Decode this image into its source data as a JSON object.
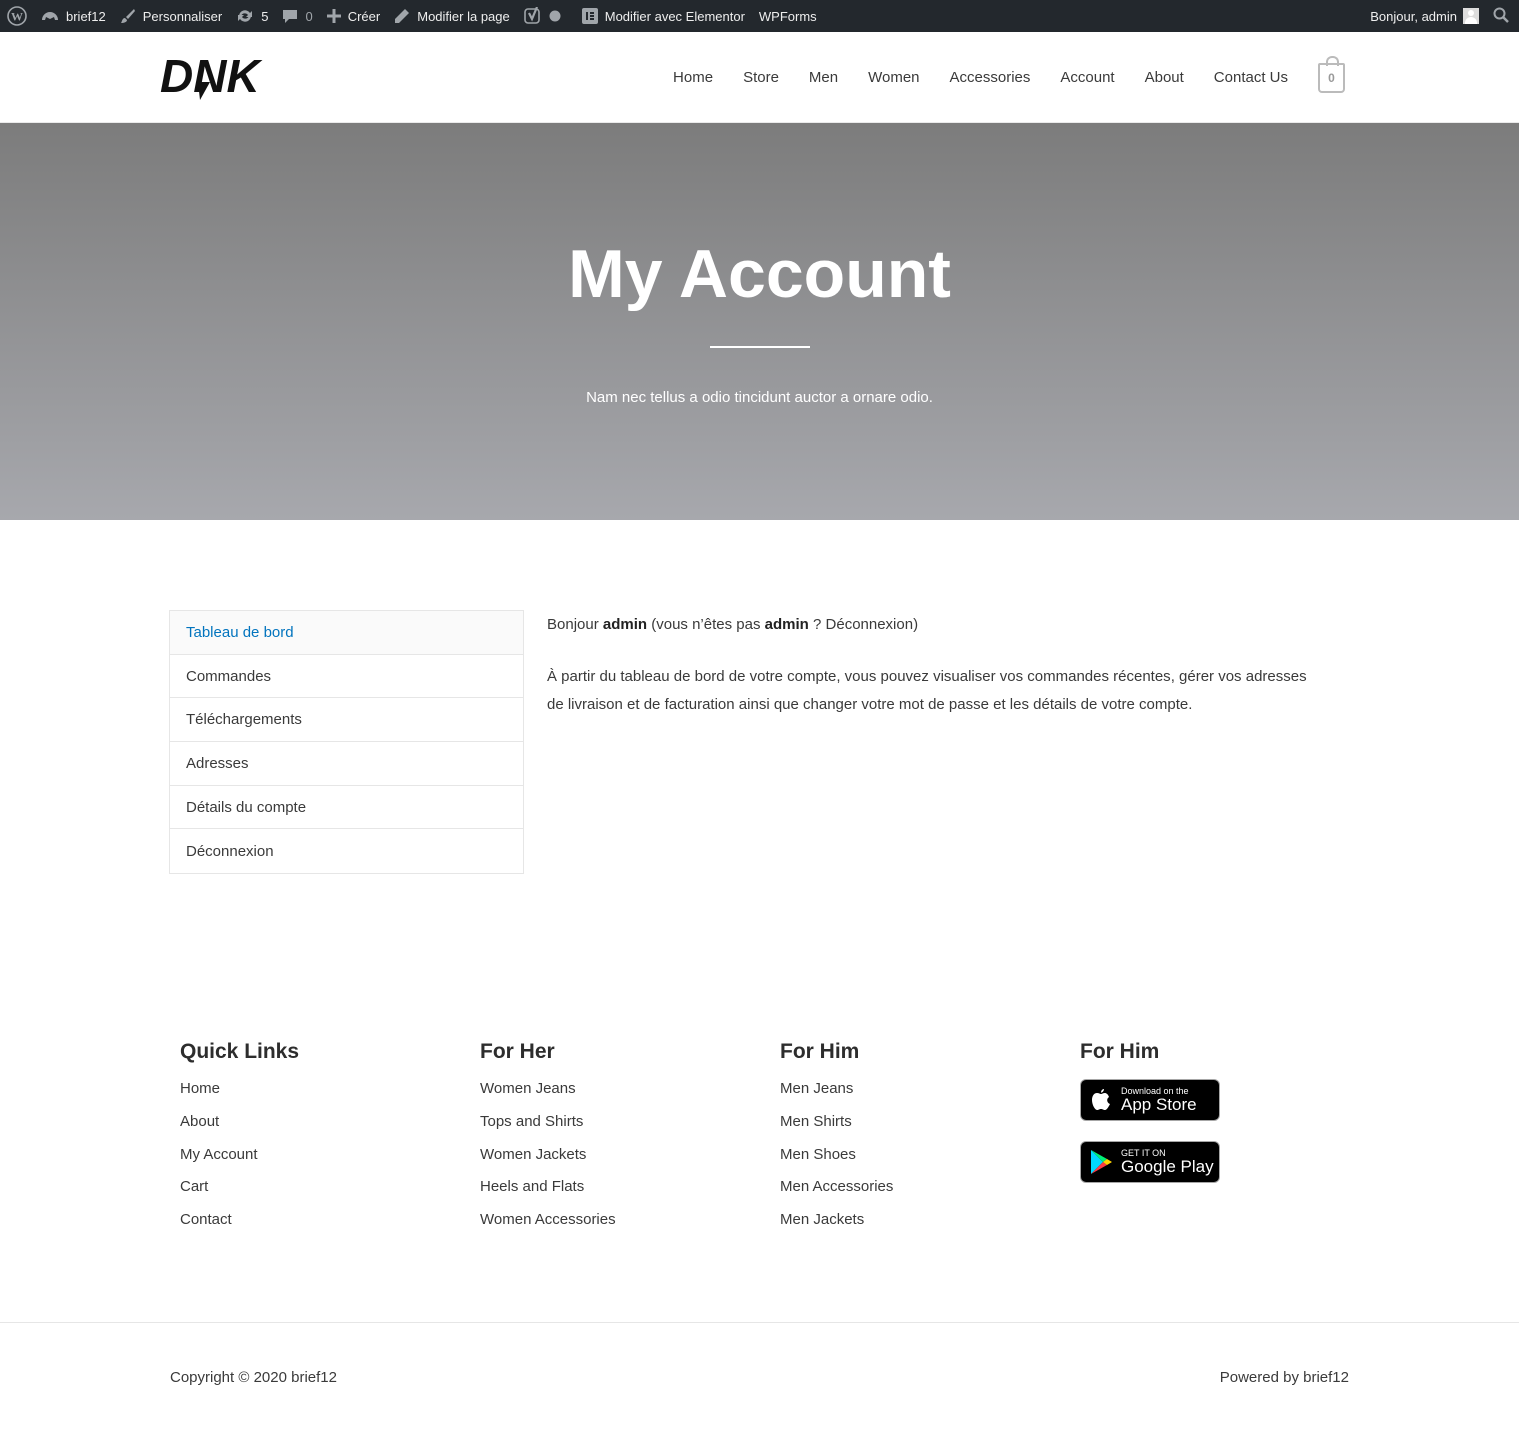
{
  "admin_bar": {
    "site": "brief12",
    "customize": "Personnaliser",
    "updates": "5",
    "comments": "0",
    "new": "Créer",
    "edit_page": "Modifier la page",
    "elementor": "Modifier avec Elementor",
    "wpforms": "WPForms",
    "greeting": "Bonjour, admin"
  },
  "header": {
    "logo_text": "DNK",
    "nav": [
      "Home",
      "Store",
      "Men",
      "Women",
      "Accessories",
      "Account",
      "About",
      "Contact Us"
    ],
    "cart_count": "0"
  },
  "hero": {
    "title": "My Account",
    "subtitle": "Nam nec tellus a odio tincidunt auctor a ornare odio."
  },
  "account": {
    "nav": [
      "Tableau de bord",
      "Commandes",
      "Téléchargements",
      "Adresses",
      "Détails du compte",
      "Déconnexion"
    ],
    "active_index": 0,
    "greeting": {
      "hello": "Bonjour",
      "user": "admin",
      "not_you_prefix": "(vous n’êtes pas",
      "user2": "admin",
      "question": "?",
      "logout": "Déconnexion",
      "close": ")"
    },
    "intro": {
      "t1": "À partir du tableau de bord de votre compte, vous pouvez visualiser vos",
      "l1": "commandes récentes",
      "t2": ", gérer vos",
      "l2": "adresses de livraison et de facturation",
      "t3": "ainsi que",
      "l3": "changer votre mot de passe et les détails de votre compte",
      "t4": "."
    }
  },
  "footer": {
    "col1": {
      "title": "Quick Links",
      "items": [
        "Home",
        "About",
        "My Account",
        "Cart",
        "Contact"
      ]
    },
    "col2": {
      "title": "For Her",
      "items": [
        "Women Jeans",
        "Tops and Shirts",
        "Women Jackets",
        "Heels and Flats",
        "Women Accessories"
      ]
    },
    "col3": {
      "title": "For Him",
      "items": [
        "Men Jeans",
        "Men Shirts",
        "Men Shoes",
        "Men Accessories",
        "Men Jackets"
      ]
    },
    "col4": {
      "title": "For Him",
      "app_store": {
        "small": "Download on the",
        "big": "App Store"
      },
      "google_play": {
        "small": "GET IT ON",
        "big": "Google Play"
      }
    },
    "copyright": "Copyright © 2020 brief12",
    "powered": "Powered by brief12"
  }
}
